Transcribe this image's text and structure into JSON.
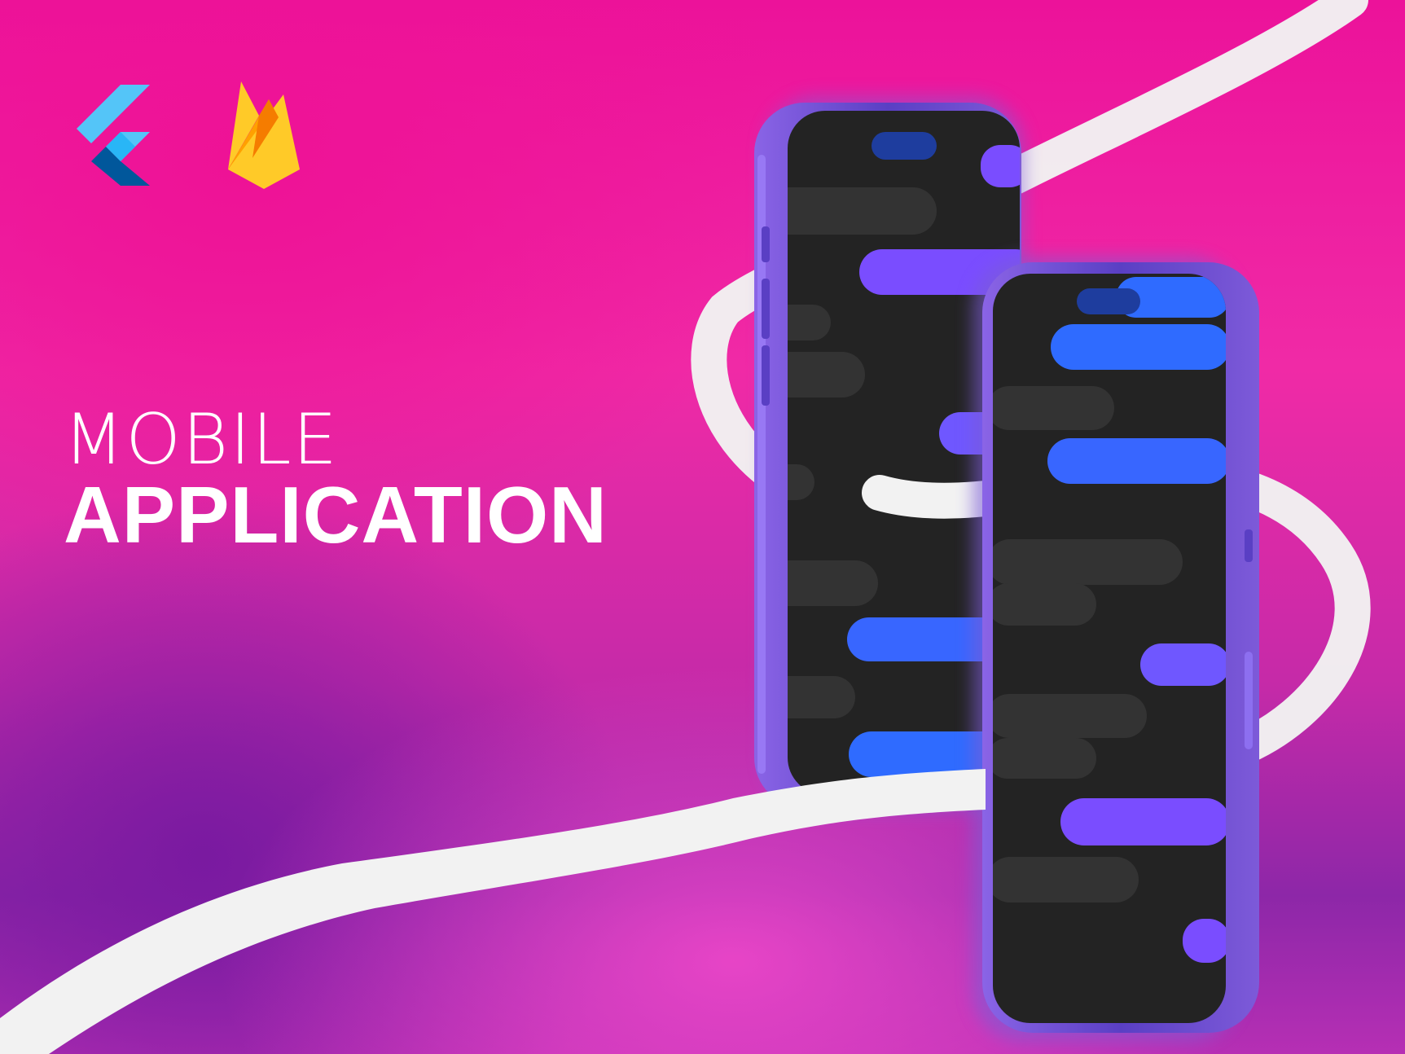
{
  "headline": {
    "line1": "MOBILE",
    "line2": "APPLICATION"
  },
  "logos": [
    {
      "icon": "flutter-logo-icon"
    },
    {
      "icon": "firebase-logo-icon"
    }
  ],
  "colors": {
    "background_pink": "#ec129a",
    "background_purple": "#8d27a8",
    "ribbon": "#f2f2f2",
    "phone_frame": "#6b4fd6",
    "screen": "#232323",
    "bubble_gray": "#333333",
    "bubble_blue": "#2f6bff",
    "bubble_purple": "#7a4dff"
  }
}
